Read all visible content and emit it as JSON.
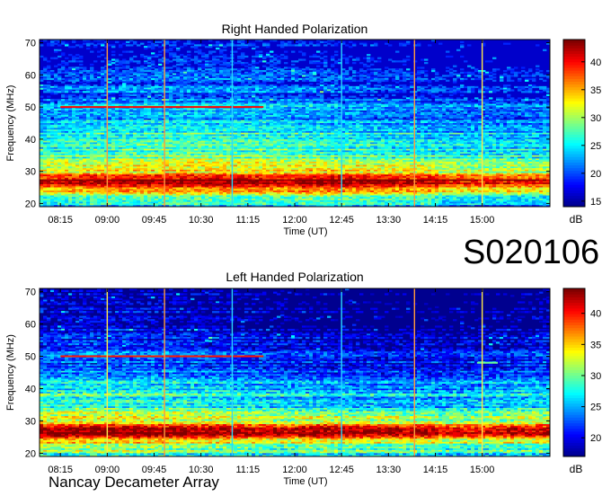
{
  "dataset_id": "S020106",
  "observatory": "Nancay Decameter Array",
  "colorbar_unit": "dB",
  "colors": {
    "background": "#ffffff",
    "colormap": [
      "#00008f",
      "#0000ff",
      "#0080ff",
      "#00ffff",
      "#80ff80",
      "#ffff00",
      "#ff8000",
      "#ff0000",
      "#800000"
    ],
    "cal_line_orange": "#ff9a3c",
    "cal_line_cyan": "#29d8ff",
    "cal_line_yellow": "#ffe84a"
  },
  "chart_data": [
    {
      "type": "heatmap",
      "title": "Right Handed Polarization",
      "xlabel": "Time (UT)",
      "ylabel": "Frequency (MHz)",
      "x_ticks": [
        "08:15",
        "09:00",
        "09:45",
        "10:30",
        "11:15",
        "12:00",
        "12:45",
        "13:30",
        "14:15",
        "15:00"
      ],
      "y_ticks": [
        20,
        30,
        40,
        50,
        60,
        70
      ],
      "ylim": [
        19,
        71
      ],
      "xlim": [
        "07:55",
        "16:05"
      ],
      "colorbar": {
        "label": "dB",
        "ticks": [
          15,
          20,
          25,
          30,
          35,
          40
        ],
        "range": [
          14,
          44
        ]
      },
      "intensity_profile_freq_mhz": [
        19,
        20,
        21,
        22,
        23,
        24,
        25,
        26,
        27,
        28,
        29,
        30,
        32,
        34,
        36,
        38,
        40,
        42,
        44,
        46,
        48,
        50,
        55,
        60,
        65,
        71
      ],
      "intensity_profile_db": [
        22,
        25,
        28,
        26,
        31,
        34,
        38,
        42,
        43,
        40,
        35,
        31,
        30,
        28,
        27,
        26,
        26,
        25,
        23,
        22,
        21,
        22,
        19,
        18,
        17,
        16
      ],
      "calibration_lines": [
        {
          "time": "09:00",
          "color": "orange"
        },
        {
          "time": "09:55",
          "color": "orange"
        },
        {
          "time": "11:00",
          "color": "cyan"
        },
        {
          "time": "12:45",
          "color": "cyan"
        },
        {
          "time": "13:55",
          "color": "orange"
        },
        {
          "time": "15:00",
          "color": "yellow"
        }
      ],
      "features": [
        {
          "freq_mhz": 50,
          "time_start": "08:15",
          "time_end": "11:30",
          "level_db": 40
        }
      ]
    },
    {
      "type": "heatmap",
      "title": "Left Handed Polarization",
      "xlabel": "Time (UT)",
      "ylabel": "Frequency (MHz)",
      "x_ticks": [
        "08:15",
        "09:00",
        "09:45",
        "10:30",
        "11:15",
        "12:00",
        "12:45",
        "13:30",
        "14:15",
        "15:00"
      ],
      "y_ticks": [
        20,
        30,
        40,
        50,
        60,
        70
      ],
      "ylim": [
        19,
        71
      ],
      "xlim": [
        "07:55",
        "16:05"
      ],
      "colorbar": {
        "label": "dB",
        "ticks": [
          20,
          25,
          30,
          35,
          40
        ],
        "range": [
          17,
          44
        ]
      },
      "intensity_profile_freq_mhz": [
        19,
        20,
        21,
        22,
        23,
        24,
        25,
        26,
        27,
        28,
        29,
        30,
        32,
        34,
        36,
        38,
        40,
        42,
        44,
        46,
        48,
        50,
        55,
        60,
        65,
        71
      ],
      "intensity_profile_db": [
        24,
        27,
        30,
        27,
        32,
        35,
        39,
        42,
        43,
        40,
        35,
        32,
        30,
        28,
        27,
        27,
        26,
        25,
        23,
        22,
        21,
        22,
        19,
        18,
        17,
        17
      ],
      "calibration_lines": [
        {
          "time": "09:00",
          "color": "yellow"
        },
        {
          "time": "09:55",
          "color": "orange"
        },
        {
          "time": "11:00",
          "color": "cyan"
        },
        {
          "time": "12:45",
          "color": "cyan"
        },
        {
          "time": "13:55",
          "color": "orange"
        },
        {
          "time": "15:00",
          "color": "yellow"
        }
      ],
      "features": [
        {
          "freq_mhz": 50,
          "time_start": "08:15",
          "time_end": "11:30",
          "level_db": 40
        },
        {
          "freq_mhz": 48,
          "time_start": "14:55",
          "time_end": "15:15",
          "level_db": 30
        }
      ]
    }
  ]
}
